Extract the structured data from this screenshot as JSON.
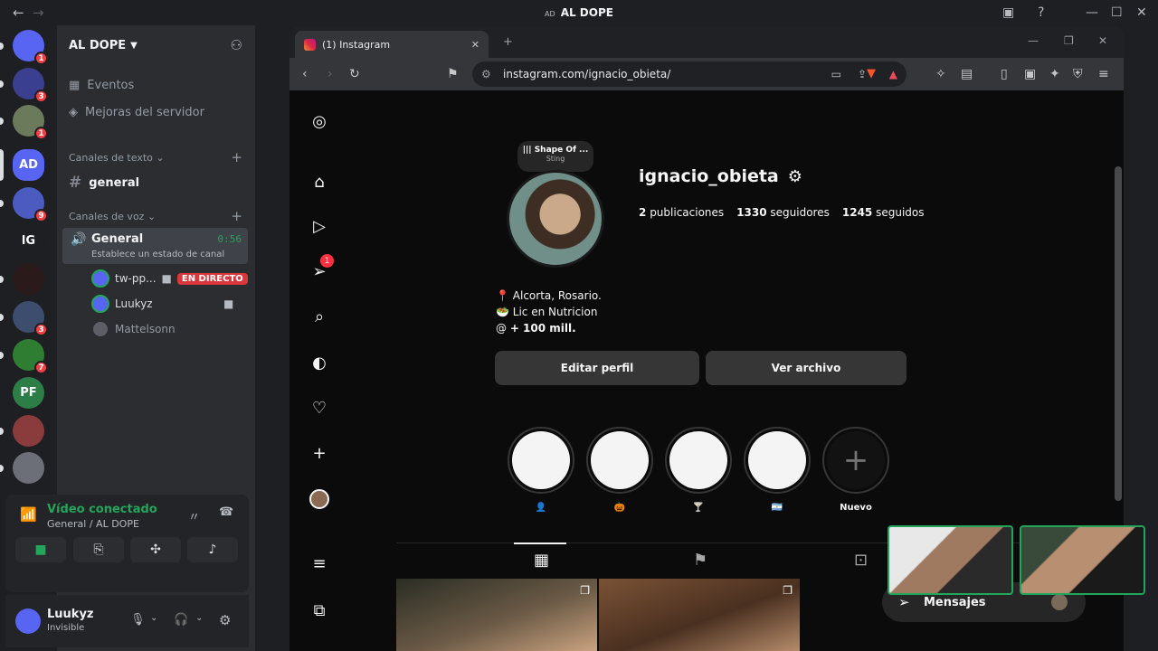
{
  "titlebar": {
    "tag": "AD",
    "title": "AL DOPE"
  },
  "servers": {
    "items": [
      {
        "label": "",
        "badge": "1",
        "color": "#5865f2"
      },
      {
        "label": "",
        "badge": "3",
        "color": "#3a3f8f"
      },
      {
        "label": "",
        "badge": "1",
        "color": "#6b7a5a"
      },
      {
        "label": "AD",
        "badge": "",
        "color": "#5865f2"
      },
      {
        "label": "",
        "badge": "9",
        "color": "#4b5bbf"
      },
      {
        "label": "lG",
        "badge": "",
        "color": "#1e1f22"
      },
      {
        "label": "",
        "badge": "",
        "color": "#2a1a1a"
      },
      {
        "label": "",
        "badge": "3",
        "color": "#3d4d6e"
      },
      {
        "label": "",
        "badge": "7",
        "color": "#2f7d32"
      },
      {
        "label": "PF",
        "badge": "",
        "color": "#2d7d46"
      },
      {
        "label": "",
        "badge": "",
        "color": "#8a3b3b"
      },
      {
        "label": "",
        "badge": "",
        "color": "#6d6f78"
      }
    ],
    "add_label": "+"
  },
  "channels": {
    "server_name": "AL DOPE",
    "eventos": "Eventos",
    "mejoras": "Mejoras del servidor",
    "text_category": "Canales de texto",
    "text_channel": "general",
    "voice_category": "Canales de voz",
    "voice_channel": "General",
    "voice_timer": "0:56",
    "voice_status": "Establece un estado de canal",
    "voice_users": [
      {
        "name": "tw-pp...",
        "live": "EN DIRECTO"
      },
      {
        "name": "Luukyz",
        "live": ""
      },
      {
        "name": "Mattelsonn",
        "live": ""
      }
    ]
  },
  "voice_panel": {
    "status": "Vídeo conectado",
    "location": "General / AL DOPE"
  },
  "user_panel": {
    "name": "Luukyz",
    "status": "Invisible"
  },
  "browser": {
    "tab_title": "(1) Instagram",
    "url": "instagram.com/ignacio_obieta/"
  },
  "instagram": {
    "note_title": "||| Shape Of ...",
    "note_sub": "Sting",
    "username": "ignacio_obieta",
    "posts_count": "2",
    "posts_label": "publicaciones",
    "followers_count": "1330",
    "followers_label": "seguidores",
    "following_count": "1245",
    "following_label": "seguidos",
    "bio_location": "Alcorta, Rosario.",
    "bio_line2": "Lic en Nutricion",
    "bio_line3": "+ 100 mill.",
    "edit_profile": "Editar perfil",
    "view_archive": "Ver archivo",
    "highlights": [
      "👤",
      "🎃",
      "🍸",
      "🇦🇷"
    ],
    "new_highlight": "Nuevo",
    "notif_badge": "1",
    "messages": "Mensajes"
  }
}
